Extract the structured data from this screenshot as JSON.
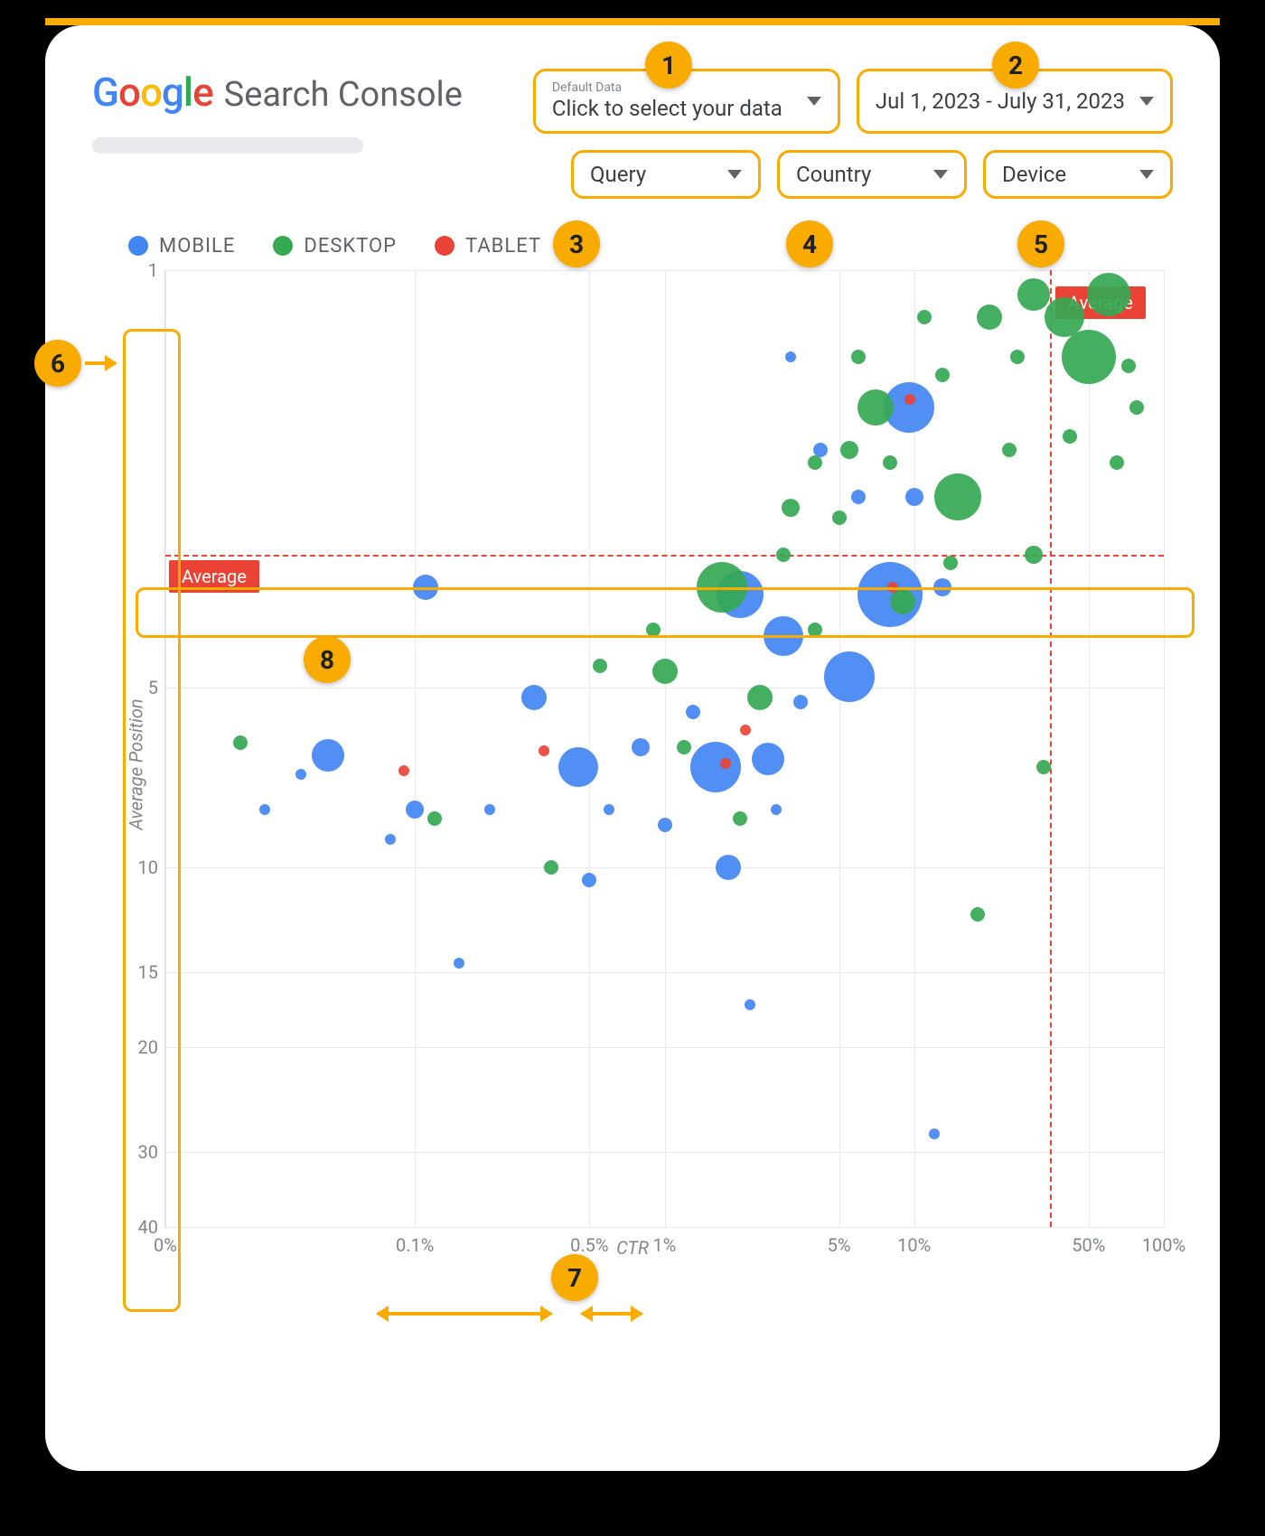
{
  "brand": {
    "name": "Google",
    "product": "Search Console"
  },
  "controls": {
    "data_select": {
      "subtitle": "Default Data",
      "label": "Click to select your data"
    },
    "date_range": {
      "label": "Jul 1, 2023 - July 31, 2023"
    },
    "query": {
      "label": "Query"
    },
    "country": {
      "label": "Country"
    },
    "device": {
      "label": "Device"
    }
  },
  "legend": {
    "mobile": "MOBILE",
    "desktop": "DESKTOP",
    "tablet": "TABLET"
  },
  "axes": {
    "x": "CTR",
    "y": "Average Position"
  },
  "average_label": "Average",
  "annotations": {
    "1": "1",
    "2": "2",
    "3": "3",
    "4": "4",
    "5": "5",
    "6": "6",
    "7": "7",
    "8": "8"
  },
  "chart_data": {
    "type": "scatter",
    "xlabel": "CTR",
    "ylabel": "Average Position",
    "x_scale": "log",
    "y_scale": "log",
    "x_ticks": [
      "0%",
      "0.1%",
      "0.5%",
      "1%",
      "5%",
      "10%",
      "50%",
      "100%"
    ],
    "y_ticks": [
      1,
      5,
      10,
      15,
      20,
      30,
      40
    ],
    "xlim_pct": [
      0.01,
      100
    ],
    "ylim": [
      1,
      40
    ],
    "avg_ctr_pct": 35,
    "avg_position": 3,
    "size_encodes": "impressions (relative)",
    "series": [
      {
        "name": "MOBILE",
        "color": "#4285F4",
        "points": [
          {
            "ctr": 0.025,
            "pos": 8,
            "r": 6
          },
          {
            "ctr": 0.035,
            "pos": 7,
            "r": 6
          },
          {
            "ctr": 0.045,
            "pos": 6.5,
            "r": 18
          },
          {
            "ctr": 0.08,
            "pos": 9,
            "r": 6
          },
          {
            "ctr": 0.1,
            "pos": 8,
            "r": 10
          },
          {
            "ctr": 0.11,
            "pos": 3.4,
            "r": 14
          },
          {
            "ctr": 0.15,
            "pos": 14.5,
            "r": 6
          },
          {
            "ctr": 0.2,
            "pos": 8,
            "r": 6
          },
          {
            "ctr": 0.3,
            "pos": 5.2,
            "r": 14
          },
          {
            "ctr": 0.45,
            "pos": 6.8,
            "r": 22
          },
          {
            "ctr": 0.5,
            "pos": 10.5,
            "r": 8
          },
          {
            "ctr": 0.6,
            "pos": 8,
            "r": 6
          },
          {
            "ctr": 0.8,
            "pos": 6.3,
            "r": 10
          },
          {
            "ctr": 1.0,
            "pos": 8.5,
            "r": 8
          },
          {
            "ctr": 1.3,
            "pos": 5.5,
            "r": 8
          },
          {
            "ctr": 1.6,
            "pos": 6.8,
            "r": 28
          },
          {
            "ctr": 2.0,
            "pos": 3.5,
            "r": 26
          },
          {
            "ctr": 1.8,
            "pos": 10,
            "r": 14
          },
          {
            "ctr": 2.2,
            "pos": 17,
            "r": 6
          },
          {
            "ctr": 2.6,
            "pos": 6.6,
            "r": 18
          },
          {
            "ctr": 2.8,
            "pos": 8,
            "r": 6
          },
          {
            "ctr": 3.0,
            "pos": 4.1,
            "r": 22
          },
          {
            "ctr": 3.2,
            "pos": 1.4,
            "r": 6
          },
          {
            "ctr": 3.5,
            "pos": 5.3,
            "r": 8
          },
          {
            "ctr": 4.2,
            "pos": 2.0,
            "r": 8
          },
          {
            "ctr": 5.5,
            "pos": 4.8,
            "r": 28
          },
          {
            "ctr": 6.0,
            "pos": 2.4,
            "r": 8
          },
          {
            "ctr": 8.0,
            "pos": 3.5,
            "r": 36
          },
          {
            "ctr": 9.5,
            "pos": 1.7,
            "r": 28
          },
          {
            "ctr": 10.0,
            "pos": 2.4,
            "r": 10
          },
          {
            "ctr": 12.0,
            "pos": 28,
            "r": 6
          },
          {
            "ctr": 13.0,
            "pos": 3.4,
            "r": 10
          }
        ]
      },
      {
        "name": "DESKTOP",
        "color": "#34A853",
        "points": [
          {
            "ctr": 0.02,
            "pos": 6.2,
            "r": 8
          },
          {
            "ctr": 0.12,
            "pos": 8.3,
            "r": 8
          },
          {
            "ctr": 0.35,
            "pos": 10,
            "r": 8
          },
          {
            "ctr": 0.55,
            "pos": 4.6,
            "r": 8
          },
          {
            "ctr": 0.9,
            "pos": 4,
            "r": 8
          },
          {
            "ctr": 1.0,
            "pos": 4.7,
            "r": 14
          },
          {
            "ctr": 1.2,
            "pos": 6.3,
            "r": 8
          },
          {
            "ctr": 1.7,
            "pos": 3.4,
            "r": 28
          },
          {
            "ctr": 2.0,
            "pos": 8.3,
            "r": 8
          },
          {
            "ctr": 2.4,
            "pos": 5.2,
            "r": 14
          },
          {
            "ctr": 3.0,
            "pos": 3.0,
            "r": 8
          },
          {
            "ctr": 3.2,
            "pos": 2.5,
            "r": 10
          },
          {
            "ctr": 4.0,
            "pos": 4.0,
            "r": 8
          },
          {
            "ctr": 4.0,
            "pos": 2.1,
            "r": 8
          },
          {
            "ctr": 5.0,
            "pos": 2.6,
            "r": 8
          },
          {
            "ctr": 5.5,
            "pos": 2.0,
            "r": 10
          },
          {
            "ctr": 6.0,
            "pos": 1.4,
            "r": 8
          },
          {
            "ctr": 7.0,
            "pos": 1.7,
            "r": 20
          },
          {
            "ctr": 8.0,
            "pos": 2.1,
            "r": 8
          },
          {
            "ctr": 9.0,
            "pos": 3.6,
            "r": 14
          },
          {
            "ctr": 11.0,
            "pos": 1.2,
            "r": 8
          },
          {
            "ctr": 13.0,
            "pos": 1.5,
            "r": 8
          },
          {
            "ctr": 14.0,
            "pos": 3.1,
            "r": 8
          },
          {
            "ctr": 15.0,
            "pos": 2.4,
            "r": 26
          },
          {
            "ctr": 18.0,
            "pos": 12,
            "r": 8
          },
          {
            "ctr": 20.0,
            "pos": 1.2,
            "r": 14
          },
          {
            "ctr": 24.0,
            "pos": 2.0,
            "r": 8
          },
          {
            "ctr": 26.0,
            "pos": 1.4,
            "r": 8
          },
          {
            "ctr": 30.0,
            "pos": 1.1,
            "r": 18
          },
          {
            "ctr": 30.0,
            "pos": 3.0,
            "r": 10
          },
          {
            "ctr": 33.0,
            "pos": 6.8,
            "r": 8
          },
          {
            "ctr": 40.0,
            "pos": 1.2,
            "r": 22
          },
          {
            "ctr": 42.0,
            "pos": 1.9,
            "r": 8
          },
          {
            "ctr": 50.0,
            "pos": 1.4,
            "r": 30
          },
          {
            "ctr": 60.0,
            "pos": 1.1,
            "r": 24
          },
          {
            "ctr": 65.0,
            "pos": 2.1,
            "r": 8
          },
          {
            "ctr": 72.0,
            "pos": 1.45,
            "r": 8
          },
          {
            "ctr": 78.0,
            "pos": 1.7,
            "r": 8
          }
        ]
      },
      {
        "name": "TABLET",
        "color": "#EA4335",
        "points": [
          {
            "ctr": 0.09,
            "pos": 6.9,
            "r": 6
          },
          {
            "ctr": 0.33,
            "pos": 6.4,
            "r": 6
          },
          {
            "ctr": 1.75,
            "pos": 6.7,
            "r": 6
          },
          {
            "ctr": 2.1,
            "pos": 5.9,
            "r": 6
          },
          {
            "ctr": 8.2,
            "pos": 3.4,
            "r": 6
          },
          {
            "ctr": 9.6,
            "pos": 1.65,
            "r": 6
          }
        ]
      }
    ]
  }
}
